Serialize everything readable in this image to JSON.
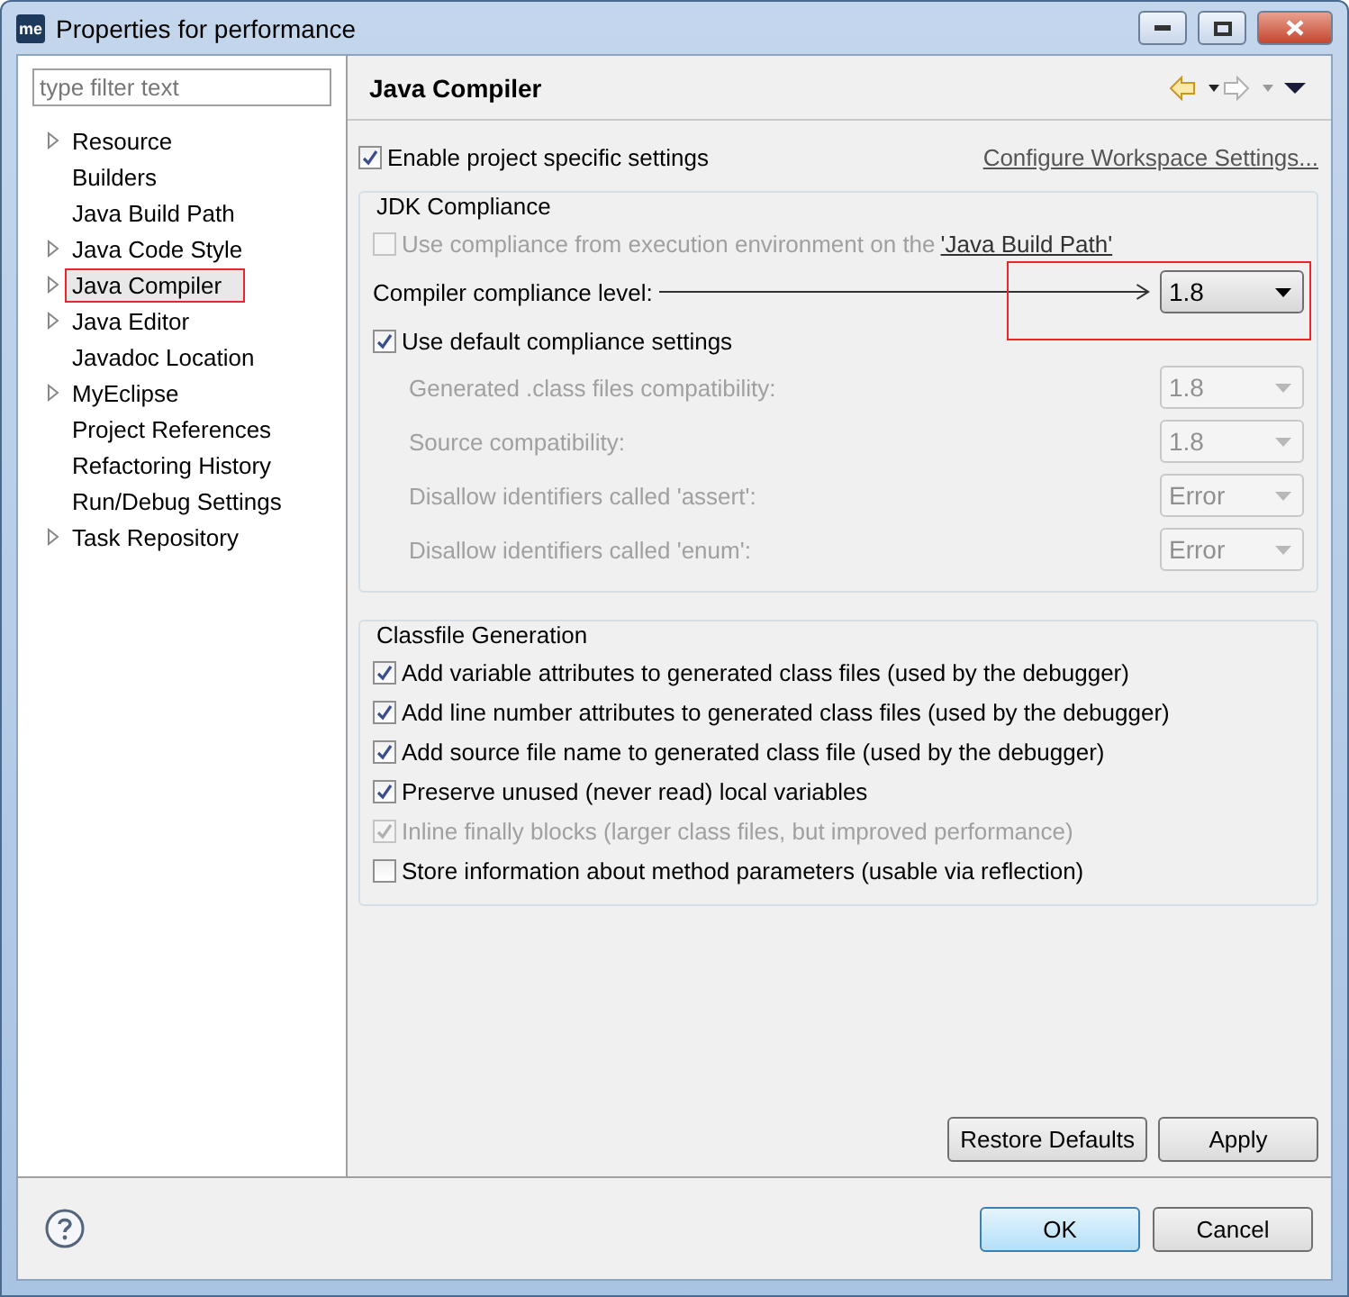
{
  "window": {
    "icon": "me",
    "title": "Properties for performance"
  },
  "filter": {
    "placeholder": "type filter text"
  },
  "tree": [
    {
      "label": "Resource",
      "expandable": true,
      "selected": false,
      "highlighted": false
    },
    {
      "label": "Builders",
      "expandable": false,
      "selected": false,
      "highlighted": false
    },
    {
      "label": "Java Build Path",
      "expandable": false,
      "selected": false,
      "highlighted": false
    },
    {
      "label": "Java Code Style",
      "expandable": true,
      "selected": false,
      "highlighted": false
    },
    {
      "label": "Java Compiler",
      "expandable": true,
      "selected": true,
      "highlighted": true
    },
    {
      "label": "Java Editor",
      "expandable": true,
      "selected": false,
      "highlighted": false
    },
    {
      "label": "Javadoc Location",
      "expandable": false,
      "selected": false,
      "highlighted": false
    },
    {
      "label": "MyEclipse",
      "expandable": true,
      "selected": false,
      "highlighted": false
    },
    {
      "label": "Project References",
      "expandable": false,
      "selected": false,
      "highlighted": false
    },
    {
      "label": "Refactoring History",
      "expandable": false,
      "selected": false,
      "highlighted": false
    },
    {
      "label": "Run/Debug Settings",
      "expandable": false,
      "selected": false,
      "highlighted": false
    },
    {
      "label": "Task Repository",
      "expandable": true,
      "selected": false,
      "highlighted": false
    }
  ],
  "page": {
    "title": "Java Compiler",
    "enable": {
      "label": "Enable project specific settings",
      "checked": true
    },
    "configure_link": "Configure Workspace Settings...",
    "jdk": {
      "title": "JDK Compliance",
      "use_ee": {
        "label": "Use compliance from execution environment on the ",
        "link": "'Java Build Path'",
        "checked": false,
        "disabled": true
      },
      "level": {
        "label": "Compiler compliance level:",
        "value": "1.8",
        "highlighted": true
      },
      "use_default": {
        "label": "Use default compliance settings",
        "checked": true
      },
      "settings": [
        {
          "label": "Generated .class files compatibility:",
          "value": "1.8",
          "disabled": true
        },
        {
          "label": "Source compatibility:",
          "value": "1.8",
          "disabled": true
        },
        {
          "label": "Disallow identifiers called 'assert':",
          "value": "Error",
          "disabled": true
        },
        {
          "label": "Disallow identifiers called 'enum':",
          "value": "Error",
          "disabled": true
        }
      ]
    },
    "classfile": {
      "title": "Classfile Generation",
      "options": [
        {
          "label": "Add variable attributes to generated class files (used by the debugger)",
          "checked": true,
          "disabled": false
        },
        {
          "label": "Add line number attributes to generated class files (used by the debugger)",
          "checked": true,
          "disabled": false
        },
        {
          "label": "Add source file name to generated class file (used by the debugger)",
          "checked": true,
          "disabled": false
        },
        {
          "label": "Preserve unused (never read) local variables",
          "checked": true,
          "disabled": false
        },
        {
          "label": "Inline finally blocks (larger class files, but improved performance)",
          "checked": true,
          "disabled": true
        },
        {
          "label": "Store information about method parameters (usable via reflection)",
          "checked": false,
          "disabled": false
        }
      ]
    },
    "buttons": [
      "Restore Defaults",
      "Apply"
    ]
  },
  "footer": {
    "buttons": [
      {
        "label": "OK",
        "default": true
      },
      {
        "label": "Cancel",
        "default": false
      }
    ]
  }
}
